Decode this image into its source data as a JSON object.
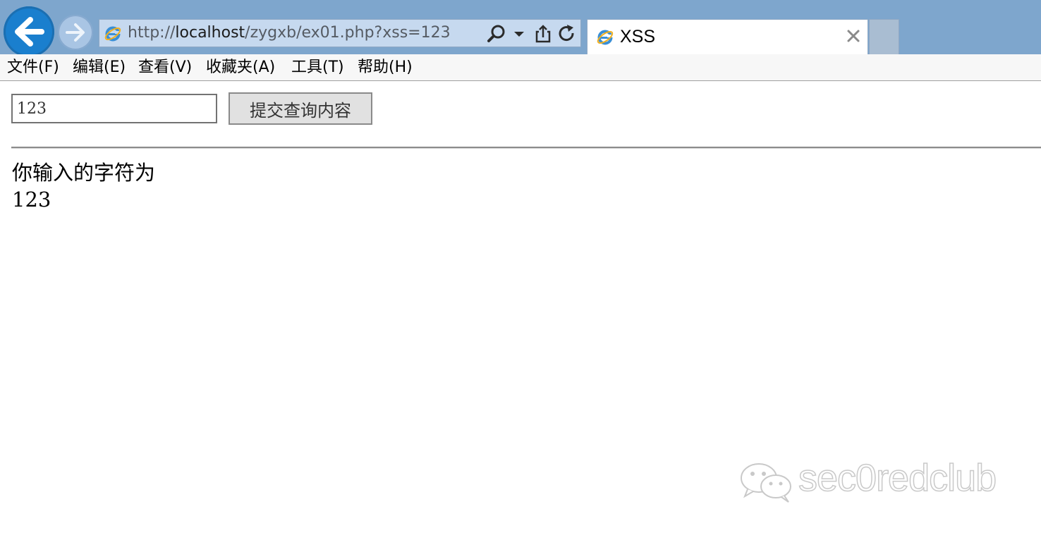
{
  "browser": {
    "address": {
      "protocol": "http://",
      "host": "localhost",
      "path": "/zygxb/ex01.php?xss=123"
    },
    "tab": {
      "title": "XSS"
    },
    "colors": {
      "chrome": "#7ea6cd",
      "back_button": "#1a7fce",
      "address_bar": "#c6d9ef"
    },
    "icons": {
      "back": "arrow-left-icon",
      "forward": "arrow-right-icon",
      "page": "ie-logo-icon",
      "search": "search-icon",
      "dropdown": "chevron-down-icon",
      "share": "share-icon",
      "refresh": "refresh-icon",
      "close": "close-icon"
    }
  },
  "menubar": {
    "items": [
      {
        "label": "文件(F)"
      },
      {
        "label": "编辑(E)"
      },
      {
        "label": "查看(V)"
      },
      {
        "label": "收藏夹(A)"
      },
      {
        "label": "工具(T)"
      },
      {
        "label": "帮助(H)"
      }
    ]
  },
  "form": {
    "input_value": "123",
    "submit_label": "提交查询内容"
  },
  "result": {
    "label": "你输入的字符为",
    "value": "123"
  },
  "watermark": {
    "text": "sec0redclub"
  }
}
